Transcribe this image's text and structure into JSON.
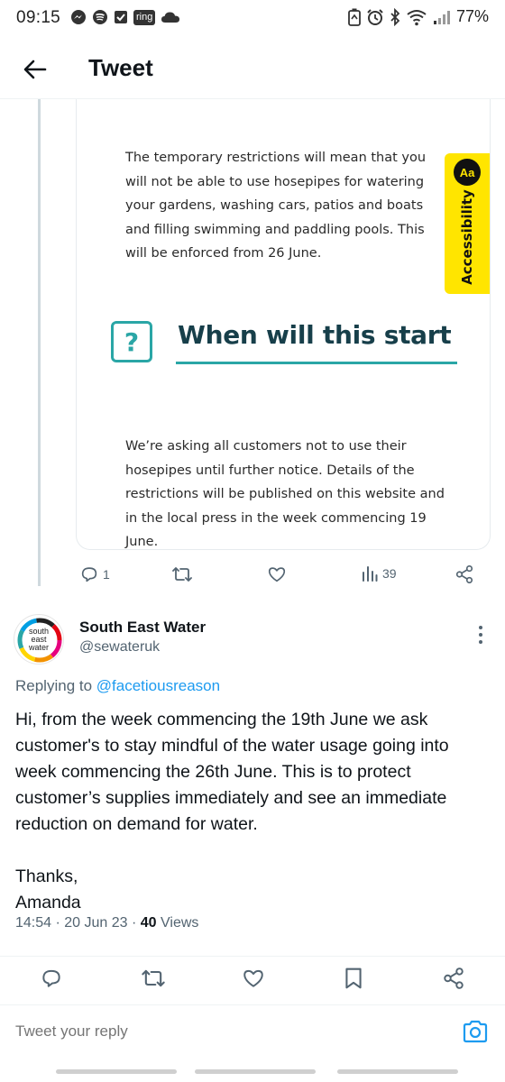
{
  "status_bar": {
    "time": "09:15",
    "left_icons": [
      "messenger-icon",
      "spotify-icon",
      "checkbox-icon",
      "ring-icon",
      "cloud-icon"
    ],
    "ring_label": "ring",
    "right_icons": [
      "battery-saver-icon",
      "alarm-icon",
      "bluetooth-icon",
      "wifi-icon",
      "signal-icon"
    ],
    "battery": "77%"
  },
  "header": {
    "title": "Tweet"
  },
  "media_card": {
    "paragraph_1": "The temporary restrictions will mean that you will not be able to use hosepipes for watering your gardens, washing cars, patios and boats and filling swimming and paddling pools. This will be enforced from 26 June.",
    "question_mark": "?",
    "section_heading": "When will this start",
    "paragraph_2": "We’re asking all customers not to use their hosepipes until further notice. Details of the restrictions will be published on this website and in the local press in the week commencing 19 June.",
    "accessibility_badge": "Aa",
    "accessibility_label": "Accessibility"
  },
  "parent_actions": {
    "reply_count": "1",
    "retweet_count": "",
    "like_count": "",
    "views_count": "39"
  },
  "reply_tweet": {
    "avatar_text": "south east water",
    "display_name": "South East Water",
    "handle": "@sewateruk",
    "replying_prefix": "Replying to",
    "replying_to": "@facetiousreason",
    "body": "Hi, from the week commencing the 19th June we ask customer's to stay mindful of the water usage going into week commencing the 26th June. This is to protect customer’s supplies immediately and see an immediate reduction on demand for water.\n\nThanks,\nAmanda",
    "time": "14:54",
    "date": "20 Jun 23",
    "views_count": "40",
    "views_label": "Views"
  },
  "composer": {
    "placeholder": "Tweet your reply"
  },
  "colors": {
    "accent": "#1d9bf0",
    "teal": "#2aa6a6",
    "heading": "#173f4a",
    "accessibility_yellow": "#ffe500"
  }
}
